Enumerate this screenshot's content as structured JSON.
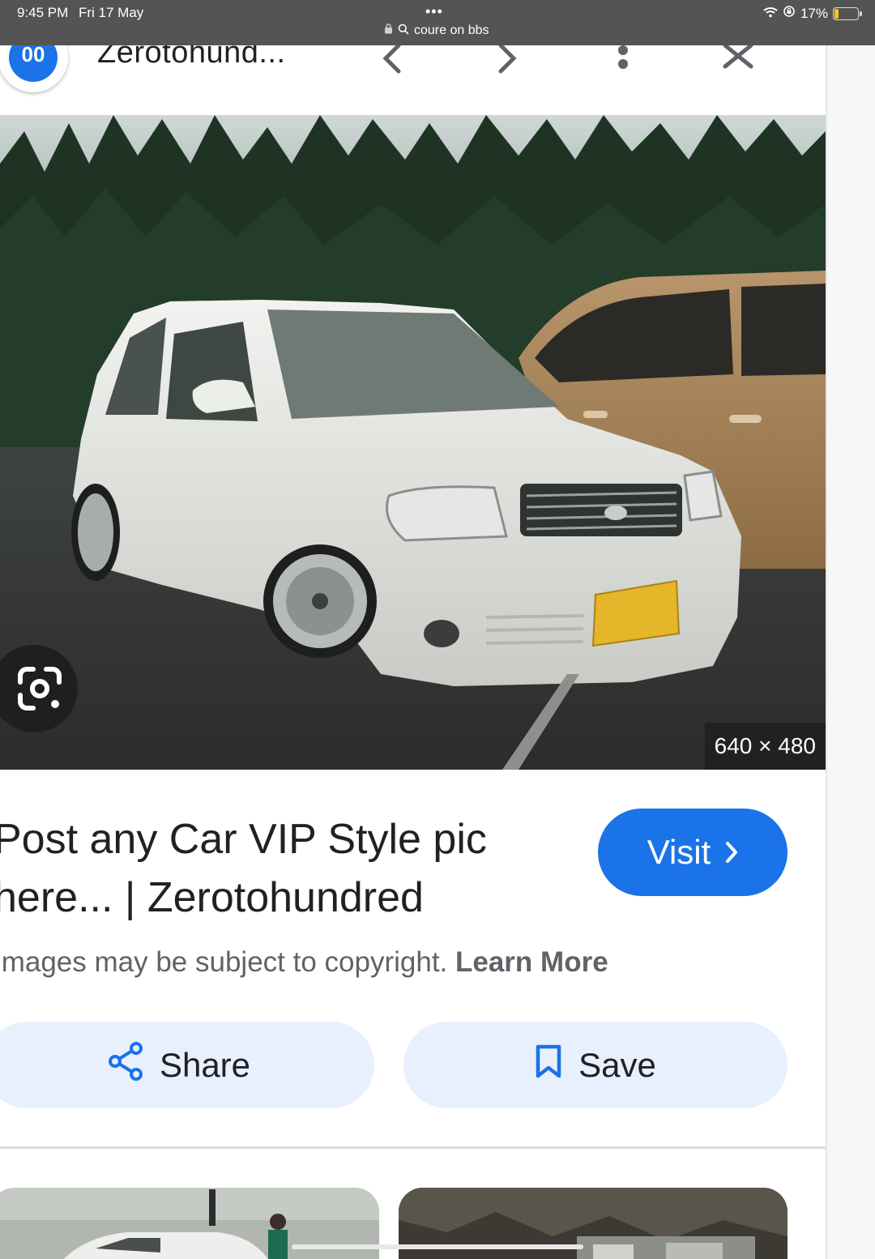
{
  "status_bar": {
    "time": "9:45 PM",
    "date": "Fri 17 May",
    "dots": "•••",
    "url": "coure on bbs",
    "battery": "17%",
    "battery_level": 0.17
  },
  "header": {
    "logo_text": "00",
    "site_title": "Zerotohund..."
  },
  "hero": {
    "dimensions": "640 × 480"
  },
  "result": {
    "title_line1": "Post any Car VIP Style pic",
    "title_line2": "here... | Zerotohundred",
    "visit_label": "Visit",
    "copyright_text": "Images may be subject to copyright. ",
    "learn_more": "Learn More"
  },
  "actions": {
    "share_label": "Share",
    "save_label": "Save"
  },
  "colors": {
    "accent": "#1a73e8",
    "chip_bg": "#e8f0fe",
    "status_bar": "#545454"
  }
}
